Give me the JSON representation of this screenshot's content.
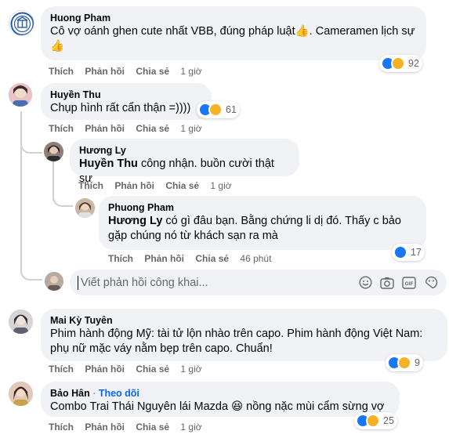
{
  "comments": [
    {
      "author": "Huong Pham",
      "text": "Cô vợ oánh ghen cute nhất VBB, đúng pháp luật👍. Cameramen lịch sự 👍",
      "actions": {
        "like": "Thích",
        "reply": "Phản hồi",
        "share": "Chia sẻ",
        "time": "1 giờ"
      },
      "reaction_count": "92"
    },
    {
      "author": "Huyền Thu",
      "text": "Chụp hình rất cẩn thận =))))",
      "actions": {
        "like": "Thích",
        "reply": "Phản hồi",
        "share": "Chia sẻ",
        "time": "1 giờ"
      },
      "reaction_count": "61",
      "replies": [
        {
          "author": "Hương Ly",
          "mention": "Huyền Thu",
          "text": " công nhận. buồn cười thật sự",
          "actions": {
            "like": "Thích",
            "reply": "Phản hồi",
            "share": "Chia sẻ",
            "time": "1 giờ"
          }
        },
        {
          "author": "Phuong Pham",
          "mention": "Hương Ly",
          "text": " có gì đâu bạn. Bằng chứng li dị đó. Thấy c bảo gặp chúng nó từ khách sạn ra mà",
          "actions": {
            "like": "Thích",
            "reply": "Phản hồi",
            "share": "Chia sẻ",
            "time": "46 phút"
          },
          "reaction_count": "17"
        }
      ]
    },
    {
      "author": "Mai Kỳ Tuyên",
      "text": "Phim hành động Mỹ: tài tử lộn nhào trên capo. Phim hành động Việt Nam: phụ nữ mặc váy nằm bẹp trên capo. Chuẩn!",
      "actions": {
        "like": "Thích",
        "reply": "Phản hồi",
        "share": "Chia sẻ",
        "time": "1 giờ"
      },
      "reaction_count": "9"
    },
    {
      "author": "Bảo Hân",
      "follow_sep": " · ",
      "follow": "Theo dõi",
      "text": "Combo Trai Thái Nguyên lái Mazda 😆 nồng nặc mùi cẩm sừng vợ",
      "actions": {
        "like": "Thích",
        "reply": "Phản hồi",
        "share": "Chia sẻ",
        "time": "1 giờ"
      },
      "reaction_count": "25"
    }
  ],
  "reply_box": {
    "placeholder": "Viết phản hồi công khai..."
  },
  "icons": [
    "emoji-icon",
    "camera-icon",
    "gif-icon",
    "sticker-icon"
  ],
  "colors": {
    "like": "#1877f2",
    "haha": "#f7b125",
    "link": "#0866ff",
    "bubble": "#f0f2f5"
  }
}
